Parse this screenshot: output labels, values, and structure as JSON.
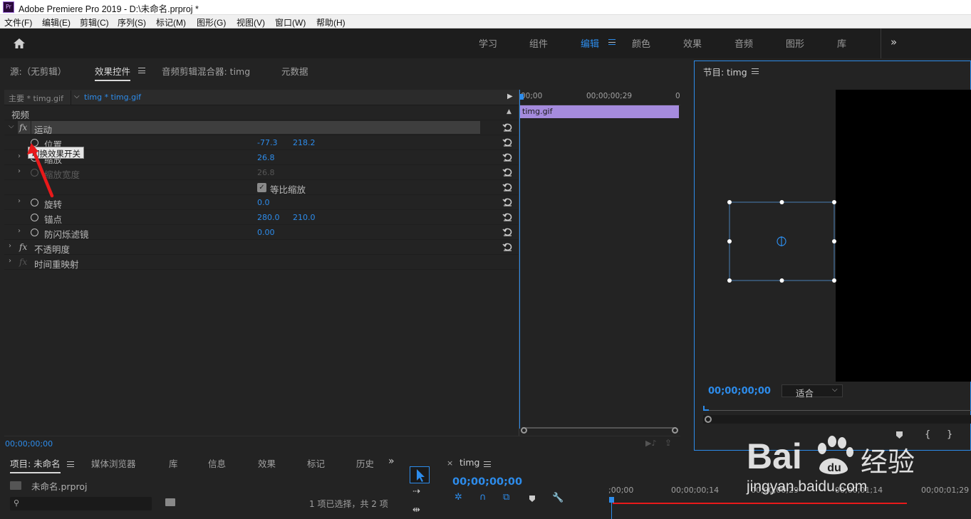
{
  "window": {
    "logo": "Pr",
    "title": "Adobe Premiere Pro 2019 - D:\\未命名.prproj *"
  },
  "menu": [
    "文件(F)",
    "编辑(E)",
    "剪辑(C)",
    "序列(S)",
    "标记(M)",
    "图形(G)",
    "视图(V)",
    "窗口(W)",
    "帮助(H)"
  ],
  "workspaces": {
    "items": [
      "学习",
      "组件",
      "编辑",
      "颜色",
      "效果",
      "音频",
      "图形",
      "库"
    ],
    "active": "编辑",
    "more": "»"
  },
  "effect_panel": {
    "tabs": [
      "源:（无剪辑）",
      "效果控件",
      "音频剪辑混合器: timg",
      "元数据"
    ],
    "active_tab": "效果控件",
    "master_clip": "主要 * timg.gif",
    "active_clip": "timg * timg.gif",
    "section_video": "视频",
    "motion": "运动",
    "tooltip": "切换效果开关",
    "properties": {
      "position": {
        "label": "位置",
        "x": "-77.3",
        "y": "218.2"
      },
      "scale": {
        "label": "缩放",
        "value": "26.8"
      },
      "scale_width": {
        "label": "缩放宽度",
        "value": "26.8"
      },
      "uniform_scale": {
        "label": "等比缩放"
      },
      "rotation": {
        "label": "旋转",
        "value": "0.0"
      },
      "anchor": {
        "label": "锚点",
        "x": "280.0",
        "y": "210.0"
      },
      "antiflicker": {
        "label": "防闪烁滤镜",
        "value": "0.00"
      }
    },
    "opacity": "不透明度",
    "time_remap": "时间重映射",
    "timeline": {
      "tick_start": "00;00",
      "tick_mid": "00;00;00;29",
      "tick_end": "0",
      "clip_name": "timg.gif"
    },
    "timecode": "00;00;00;00"
  },
  "program_monitor": {
    "title": "节目: timg",
    "timecode": "00;00;00;00",
    "fit": "适合"
  },
  "project_panel": {
    "tabs": [
      "项目: 未命名",
      "媒体浏览器",
      "库",
      "信息",
      "效果",
      "标记",
      "历史"
    ],
    "active_tab": "项目: 未命名",
    "project_file": "未命名.prproj",
    "search_placeholder": "",
    "selection_status": "1 项已选择，共 2 项",
    "more": "»"
  },
  "sequence": {
    "close": "×",
    "name": "timg",
    "timecode": "00;00;00;00",
    "ticks": [
      ";00;00",
      "00;00;00;14",
      "00;00;00;29",
      "00;00;01;14",
      "00;00;01;29"
    ]
  },
  "watermark": {
    "brand": "Bai",
    "brand_suffix": "经验",
    "url": "jingyan.baidu.com"
  },
  "colors": {
    "accent": "#2d8ceb",
    "clip": "#a58bdd",
    "annotation_arrow": "#e8191a"
  }
}
